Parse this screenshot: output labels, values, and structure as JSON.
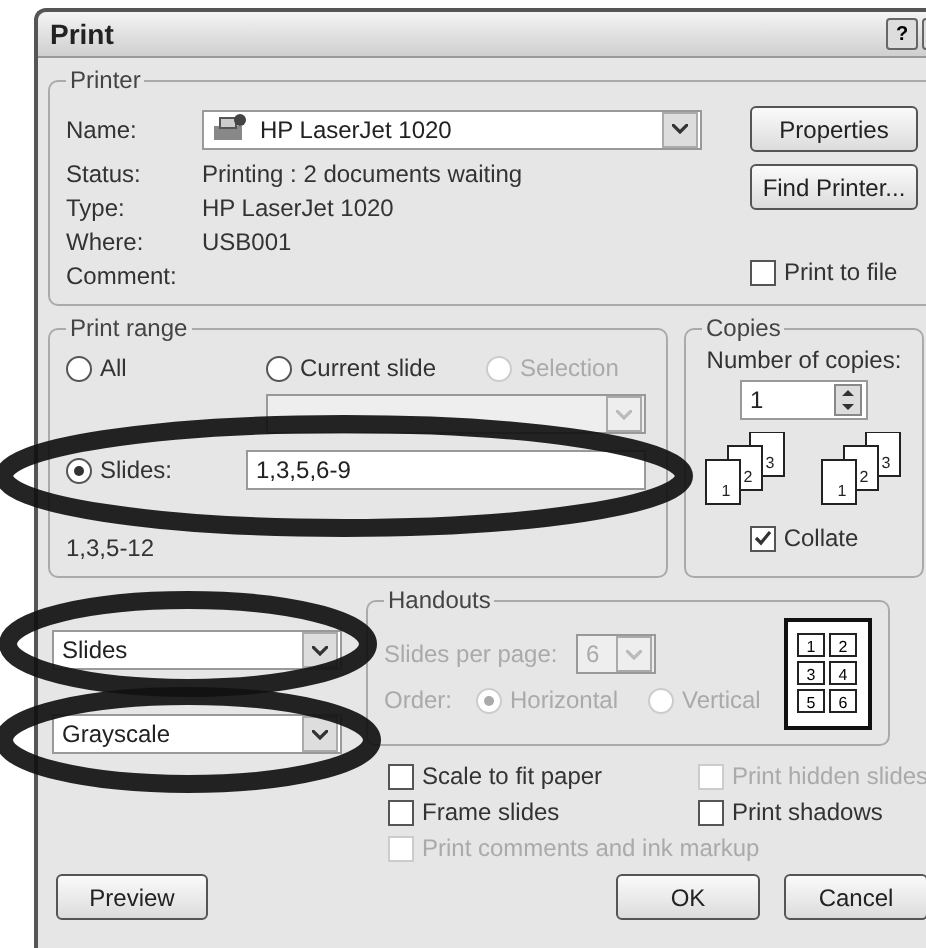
{
  "window": {
    "title": "Print",
    "help": "?"
  },
  "printer": {
    "legend": "Printer",
    "name_label": "Name:",
    "name_value": "HP LaserJet 1020",
    "info": [
      {
        "label": "Status:",
        "value": "Printing : 2 documents waiting"
      },
      {
        "label": "Type:",
        "value": "HP LaserJet 1020"
      },
      {
        "label": "Where:",
        "value": "USB001"
      },
      {
        "label": "Comment:"
      }
    ],
    "buttons": [
      "Properties",
      "Find Printer..."
    ],
    "print_to_file": {
      "label": "Print to file",
      "checked": false
    }
  },
  "print_range": {
    "legend": "Print range",
    "options": [
      {
        "label": "All",
        "selected": false,
        "disabled": false
      },
      {
        "label": "Current slide",
        "selected": false,
        "disabled": false
      },
      {
        "label": "Selection",
        "selected": false,
        "disabled": true
      },
      {
        "label": "Slides:",
        "selected": true,
        "disabled": false
      }
    ],
    "slides_value": "1,3,5,6-9",
    "hint": "1,3,5-12"
  },
  "copies": {
    "legend": "Copies",
    "label": "Number of copies:",
    "value": "1",
    "stacks": [
      [
        "1",
        "2",
        "3"
      ],
      [
        "1",
        "2",
        "3"
      ]
    ],
    "collate": {
      "label": "Collate",
      "checked": true
    }
  },
  "print_what": {
    "value": "Slides"
  },
  "color_mode": {
    "value": "Grayscale"
  },
  "handouts": {
    "legend": "Handouts",
    "disabled": true,
    "per_page_label": "Slides per page:",
    "per_page_value": "6",
    "order_label": "Order:",
    "orders": [
      {
        "label": "Horizontal",
        "selected": true
      },
      {
        "label": "Vertical",
        "selected": false
      }
    ],
    "preview_numbers": [
      "1",
      "2",
      "3",
      "4",
      "5",
      "6"
    ]
  },
  "options": [
    {
      "label": "Scale to fit paper",
      "checked": false,
      "disabled": false
    },
    {
      "label": "Print hidden slides",
      "checked": false,
      "disabled": true
    },
    {
      "label": "Frame slides",
      "checked": false,
      "disabled": false
    },
    {
      "label": "Print shadows",
      "checked": false,
      "disabled": false
    },
    {
      "label": "Print comments and ink markup",
      "checked": false,
      "disabled": true
    }
  ],
  "buttons": [
    {
      "label": "Preview"
    },
    {
      "label": "OK"
    },
    {
      "label": "Cancel"
    }
  ],
  "annotations": [
    {
      "kind": "marker-loop"
    },
    {
      "kind": "marker-loop"
    },
    {
      "kind": "marker-loop"
    }
  ]
}
